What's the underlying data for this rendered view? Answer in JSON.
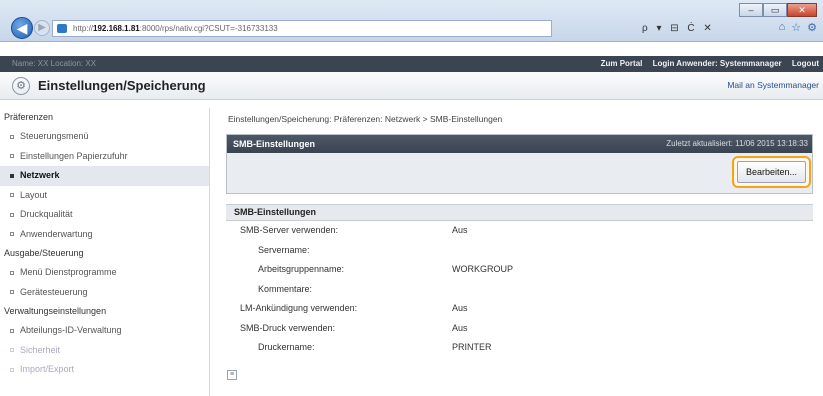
{
  "browser": {
    "address_prefix": "http://",
    "address_host": "192.168.1.81",
    "address_rest": ":8000/rps/nativ.cgi?CSUT=-316733133",
    "search_placeholder": "ρ ▾ ⊟ Ċ ✕",
    "back": "◀",
    "forward": "▶",
    "min": "–",
    "max": "▭",
    "close": "✕"
  },
  "app": {
    "device_label": "Name: XX   Location: XX",
    "portal_link": "Zum Portal",
    "login_user": "Login Anwender: Systemmanager",
    "logout": "Logout",
    "page_title": "Einstellungen/Speicherung",
    "mail_link": "Mail an Systemmanager"
  },
  "sidebar": {
    "groups": [
      {
        "heading": "Präferenzen",
        "items": [
          {
            "label": "Steuerungsmenü"
          },
          {
            "label": "Einstellungen Papierzufuhr"
          },
          {
            "label": "Netzwerk"
          },
          {
            "label": "Layout"
          },
          {
            "label": "Druckqualität"
          },
          {
            "label": "Anwenderwartung"
          }
        ]
      },
      {
        "heading": "Ausgabe/Steuerung",
        "items": [
          {
            "label": "Menü Dienstprogramme"
          },
          {
            "label": "Gerätesteuerung"
          }
        ]
      },
      {
        "heading": "Verwaltungseinstellungen",
        "items": [
          {
            "label": "Abteilungs-ID-Verwaltung"
          },
          {
            "label": "Sicherheit"
          },
          {
            "label": "Import/Export"
          }
        ]
      }
    ]
  },
  "main": {
    "breadcrumb": "Einstellungen/Speicherung: Präferenzen: Netzwerk > SMB-Einstellungen",
    "panel_title": "SMB-Einstellungen",
    "last_updated": "Zuletzt aktualisiert: 11/06 2015 13:18:33",
    "edit_button": "Bearbeiten...",
    "section_title": "SMB-Einstellungen",
    "rows": [
      {
        "label": "SMB-Server verwenden:",
        "value": "Aus"
      },
      {
        "label": "Servername:",
        "value": ""
      },
      {
        "label": "Arbeitsgruppenname:",
        "value": "WORKGROUP"
      },
      {
        "label": "Kommentare:",
        "value": ""
      },
      {
        "label": "LM-Ankündigung verwenden:",
        "value": "Aus"
      },
      {
        "label": "SMB-Druck verwenden:",
        "value": "Aus"
      },
      {
        "label": "Druckername:",
        "value": "PRINTER"
      }
    ]
  }
}
